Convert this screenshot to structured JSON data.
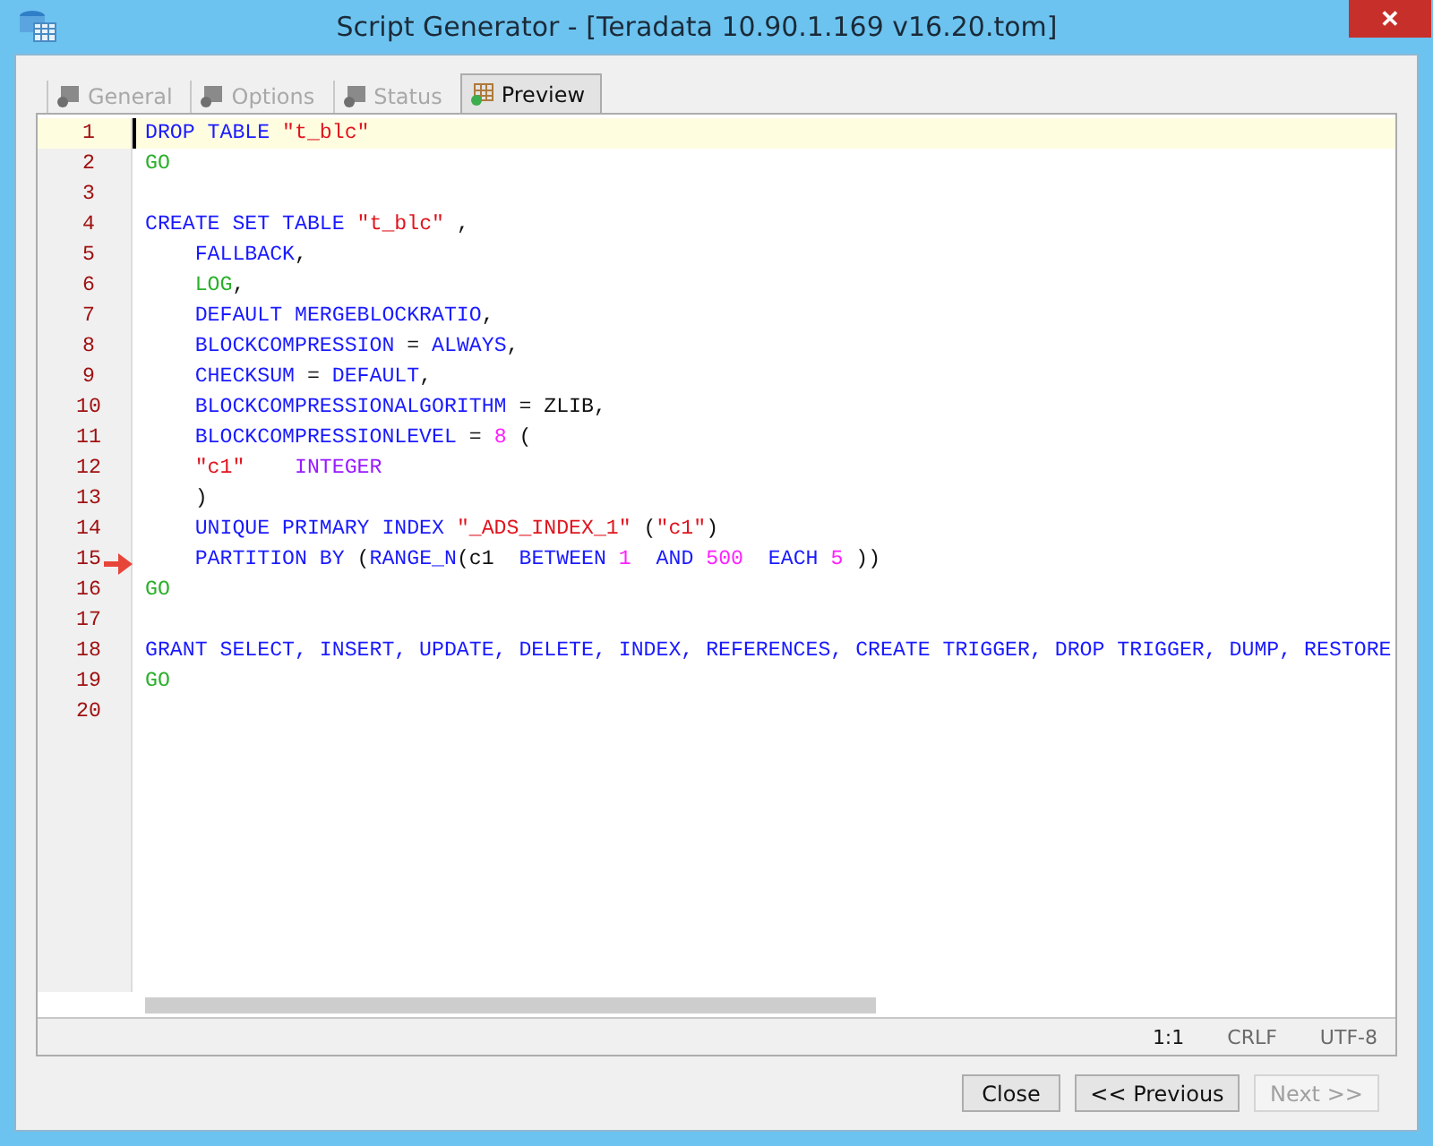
{
  "window": {
    "title": "Script Generator - [Teradata 10.90.1.169 v16.20.tom]",
    "close": "✕"
  },
  "tabs": [
    {
      "label": "General",
      "selected": false,
      "disabled": true
    },
    {
      "label": "Options",
      "selected": false,
      "disabled": true
    },
    {
      "label": "Status",
      "selected": false,
      "disabled": true
    },
    {
      "label": "Preview",
      "selected": true,
      "disabled": false
    }
  ],
  "editor": {
    "lines": [
      {
        "number": "1",
        "current": true,
        "tokens": [
          {
            "kind": "kw",
            "text": "DROP TABLE "
          },
          {
            "kind": "str",
            "text": "\"t_blc\""
          }
        ]
      },
      {
        "number": "2",
        "current": false,
        "tokens": [
          {
            "kind": "go",
            "text": "GO"
          }
        ]
      },
      {
        "number": "3",
        "current": false
      },
      {
        "number": "4",
        "current": false,
        "tokens": [
          {
            "kind": "kw",
            "text": "CREATE SET TABLE "
          },
          {
            "kind": "str",
            "text": "\"t_blc\""
          },
          {
            "kind": "plain",
            "text": " ,"
          }
        ]
      },
      {
        "number": "5",
        "current": false,
        "tokens": [
          {
            "kind": "kw",
            "text": "    FALLBACK"
          },
          {
            "kind": "plain",
            "text": ","
          }
        ]
      },
      {
        "number": "6",
        "current": false,
        "tokens": [
          {
            "kind": "go",
            "text": "    LOG"
          },
          {
            "kind": "plain",
            "text": ","
          }
        ]
      },
      {
        "number": "7",
        "current": false,
        "tokens": [
          {
            "kind": "kw",
            "text": "    DEFAULT MERGEBLOCKRATIO"
          },
          {
            "kind": "plain",
            "text": ","
          }
        ]
      },
      {
        "number": "8",
        "current": false,
        "tokens": [
          {
            "kind": "kw",
            "text": "    BLOCKCOMPRESSION"
          },
          {
            "kind": "plain",
            "text": " = "
          },
          {
            "kind": "kw",
            "text": "ALWAYS"
          },
          {
            "kind": "plain",
            "text": ","
          }
        ]
      },
      {
        "number": "9",
        "current": false,
        "tokens": [
          {
            "kind": "kw",
            "text": "    CHECKSUM"
          },
          {
            "kind": "plain",
            "text": " = "
          },
          {
            "kind": "kw",
            "text": "DEFAULT"
          },
          {
            "kind": "plain",
            "text": ","
          }
        ]
      },
      {
        "number": "10",
        "current": false,
        "tokens": [
          {
            "kind": "kw",
            "text": "    BLOCKCOMPRESSIONALGORITHM"
          },
          {
            "kind": "plain",
            "text": " = ZLIB,"
          }
        ]
      },
      {
        "number": "11",
        "current": false,
        "tokens": [
          {
            "kind": "kw",
            "text": "    BLOCKCOMPRESSIONLEVEL"
          },
          {
            "kind": "plain",
            "text": " = "
          },
          {
            "kind": "num",
            "text": "8"
          },
          {
            "kind": "plain",
            "text": " ("
          }
        ]
      },
      {
        "number": "12",
        "current": false,
        "tokens": [
          {
            "kind": "str",
            "text": "    \"c1\"    "
          },
          {
            "kind": "type",
            "text": "INTEGER"
          }
        ]
      },
      {
        "number": "13",
        "current": false,
        "tokens": [
          {
            "kind": "plain",
            "text": "    )"
          }
        ]
      },
      {
        "number": "14",
        "current": false,
        "tokens": [
          {
            "kind": "kw",
            "text": "    UNIQUE PRIMARY INDEX "
          },
          {
            "kind": "str",
            "text": "\"_ADS_INDEX_1\""
          },
          {
            "kind": "plain",
            "text": " ("
          },
          {
            "kind": "str",
            "text": "\"c1\""
          },
          {
            "kind": "plain",
            "text": ")"
          }
        ]
      },
      {
        "number": "15",
        "current": false,
        "tokens": [
          {
            "kind": "kw",
            "text": "    PARTITION BY "
          },
          {
            "kind": "plain",
            "text": "("
          },
          {
            "kind": "kw",
            "text": "RANGE_N"
          },
          {
            "kind": "plain",
            "text": "(c1  "
          },
          {
            "kind": "kw",
            "text": "BETWEEN "
          },
          {
            "kind": "num",
            "text": "1"
          },
          {
            "kind": "kw",
            "text": "  AND "
          },
          {
            "kind": "num",
            "text": "500"
          },
          {
            "kind": "kw",
            "text": "  EACH "
          },
          {
            "kind": "num",
            "text": "5"
          },
          {
            "kind": "plain",
            "text": " ))"
          }
        ]
      },
      {
        "number": "16",
        "current": false,
        "tokens": [
          {
            "kind": "go",
            "text": "GO"
          }
        ]
      },
      {
        "number": "17",
        "current": false
      },
      {
        "number": "18",
        "current": false,
        "tokens": [
          {
            "kind": "kw",
            "text": "GRANT SELECT, INSERT, UPDATE, DELETE, INDEX, REFERENCES, CREATE TRIGGER, DROP TRIGGER, DUMP, RESTORE"
          }
        ]
      },
      {
        "number": "19",
        "current": false,
        "tokens": [
          {
            "kind": "go",
            "text": "GO"
          }
        ]
      },
      {
        "number": "20",
        "current": false
      }
    ]
  },
  "status_bar": [
    "1:1",
    "CRLF",
    "UTF-8"
  ],
  "buttons": [
    {
      "label": "Close",
      "disabled": false
    },
    {
      "label": "<< Previous",
      "disabled": false
    },
    {
      "label": "Next >>",
      "disabled": true
    }
  ]
}
